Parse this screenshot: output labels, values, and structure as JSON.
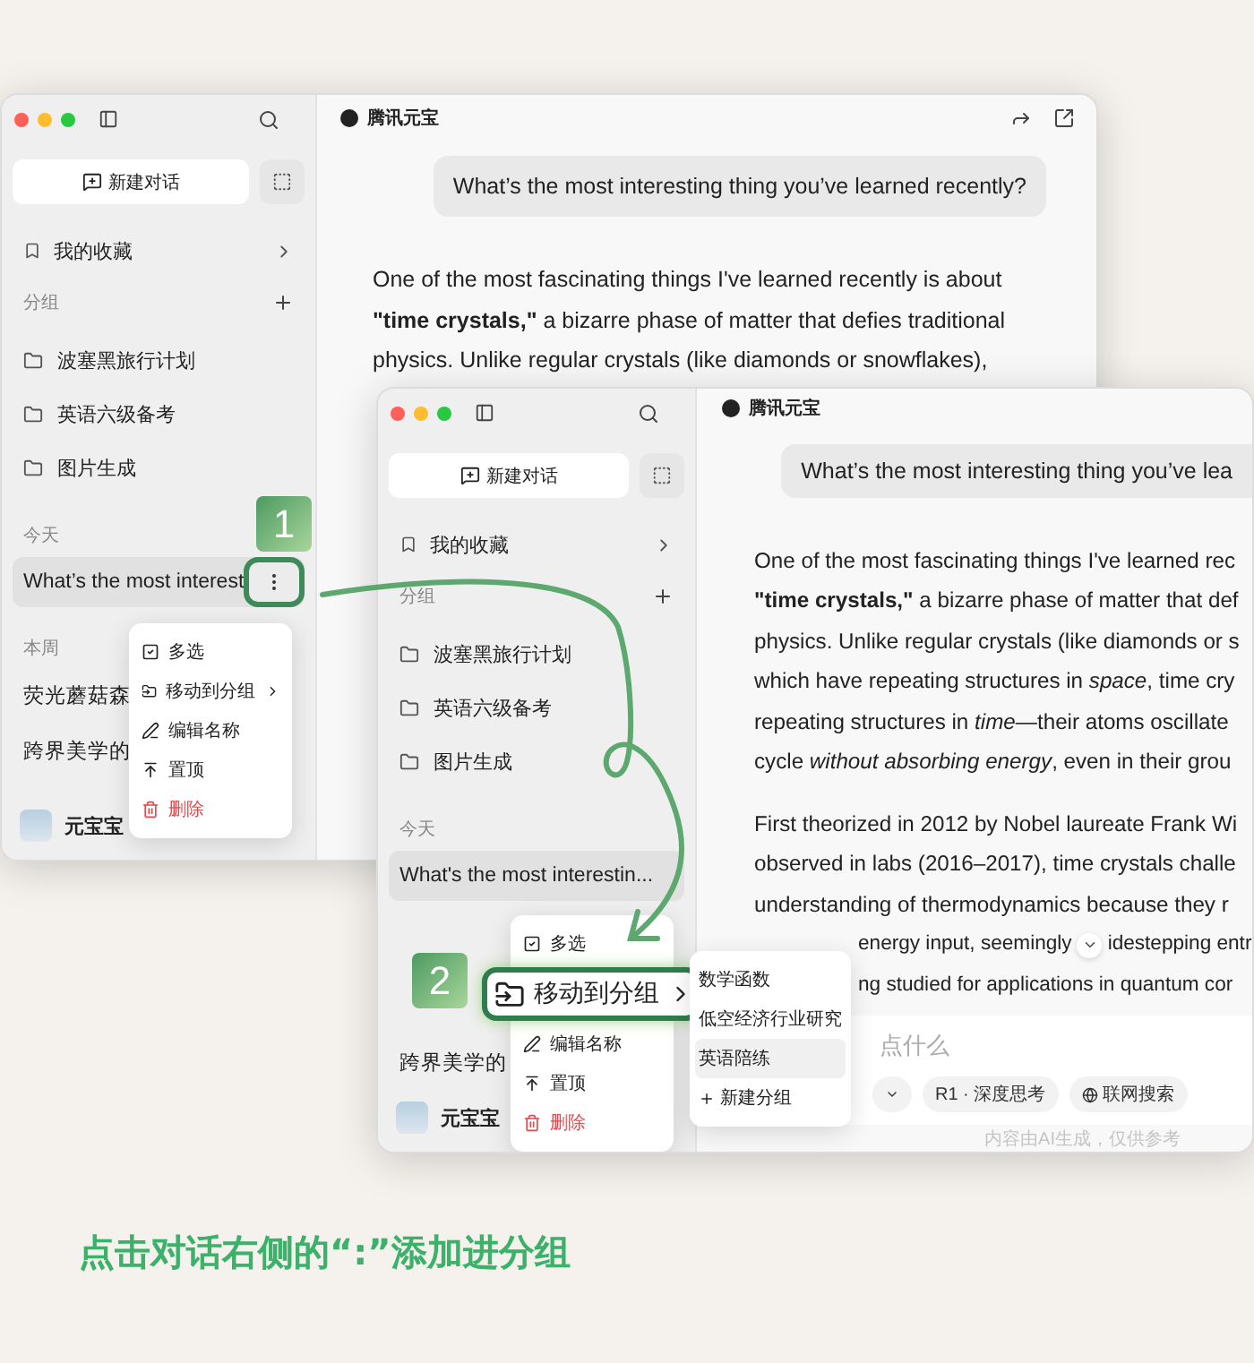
{
  "windows": [
    {
      "app_title": "腾讯元宝",
      "header_actions": true,
      "sidebar": {
        "new_chat": "新建对话",
        "favorites": "我的收藏",
        "groups_label": "分组",
        "groups": [
          "波塞黑旅行计划",
          "英语六级备考",
          "图片生成"
        ],
        "sections": [
          {
            "label": "今天",
            "chats": [
              {
                "title": "What’s the most interest",
                "selected": true,
                "hovered": true
              }
            ]
          },
          {
            "label": "本周",
            "chats": [
              {
                "title": "荧光蘑菇森",
                "selected": false,
                "hovered": false
              },
              {
                "title": "跨界美学的",
                "selected": false,
                "hovered": false
              }
            ]
          }
        ],
        "user": "元宝宝"
      },
      "context_menu": [
        {
          "label": "多选",
          "kind": "multi-select",
          "callout": false
        },
        {
          "label": "移动到分组",
          "kind": "move",
          "callout": false
        },
        {
          "label": "编辑名称",
          "kind": "rename",
          "callout": false
        },
        {
          "label": "置顶",
          "kind": "pin",
          "callout": false
        },
        {
          "label": "删除",
          "kind": "delete",
          "callout": false
        }
      ],
      "chat": {
        "question": "What’s the most interesting thing you’ve learned recently?",
        "paragraphs": [
          [
            {
              "text": "One of the most fascinating things I've learned recently is about",
              "kind": "full"
            },
            {
              "text": "**\"time crystals,\"** a bizarre phase of matter that defies traditional",
              "kind": "full"
            },
            {
              "text": "physics. Unlike regular crystals (like diamonds or snowflakes),",
              "kind": "full"
            }
          ]
        ]
      }
    },
    {
      "app_title": "腾讯元宝",
      "header_actions": false,
      "sidebar": {
        "new_chat": "新建对话",
        "favorites": "我的收藏",
        "groups_label": "分组",
        "groups": [
          "波塞黑旅行计划",
          "英语六级备考",
          "图片生成"
        ],
        "sections": [
          {
            "label": "今天",
            "chats": [
              {
                "title": "What's the most interestin...",
                "selected": true,
                "hovered": false
              }
            ]
          },
          {
            "chats": [
              {
                "title": "跨界美学的",
                "selected": false,
                "hovered": false
              }
            ]
          }
        ],
        "user": "元宝宝"
      },
      "context_menu": [
        {
          "label": "多选",
          "kind": "multi-select",
          "callout": false
        },
        {
          "label": "移动到分组",
          "kind": "move",
          "callout": true
        },
        {
          "label": "编辑名称",
          "kind": "rename",
          "callout": false
        },
        {
          "label": "置顶",
          "kind": "pin",
          "callout": false
        },
        {
          "label": "删除",
          "kind": "delete",
          "callout": false
        }
      ],
      "submenu": {
        "items": [
          {
            "label": "数学函数",
            "selected": false
          },
          {
            "label": "低空经济行业研究",
            "selected": false
          },
          {
            "label": "英语陪练",
            "selected": true
          }
        ],
        "new_group": "新建分组"
      },
      "chat": {
        "question": "What’s the most interesting thing you’ve lea",
        "paragraphs": [
          [
            {
              "text": "One of the most fascinating things I've learned rec",
              "kind": "full"
            },
            {
              "text": "**\"time crystals,\"** a bizarre phase of matter that def",
              "kind": "full"
            },
            {
              "text": "physics. Unlike regular crystals (like diamonds or s",
              "kind": "full"
            },
            {
              "text": "which have repeating structures in *space*, time cry",
              "kind": "full"
            },
            {
              "text": "repeating structures in *time*—their atoms oscillate",
              "kind": "full"
            },
            {
              "text": "cycle *without absorbing energy*, even in their grou",
              "kind": "full"
            }
          ],
          [
            {
              "text": "First theorized in 2012 by Nobel laureate Frank Wi",
              "kind": "full"
            },
            {
              "text": "observed in labs (2016–2017), time crystals challe",
              "kind": "full"
            },
            {
              "text": "understanding of thermodynamics because they r",
              "kind": "full"
            },
            {
              "segments": [
                "energy input, seemingly",
                "idestepping entr"
              ],
              "kind": "partial"
            },
            {
              "text": "ng studied for applications in quantum cor",
              "kind": "partial"
            }
          ]
        ],
        "composer": {
          "placeholder": "点什么",
          "buttons": [
            {
              "label": "R1 · 深度思考",
              "kind": "deep-think"
            },
            {
              "label": "联网搜索",
              "kind": "web-search"
            }
          ],
          "disclaimer": "内容由AI生成，仅供参考"
        }
      }
    }
  ],
  "steps": [
    "1",
    "2"
  ],
  "caption": "点击对话右侧的“:”添加进分组"
}
